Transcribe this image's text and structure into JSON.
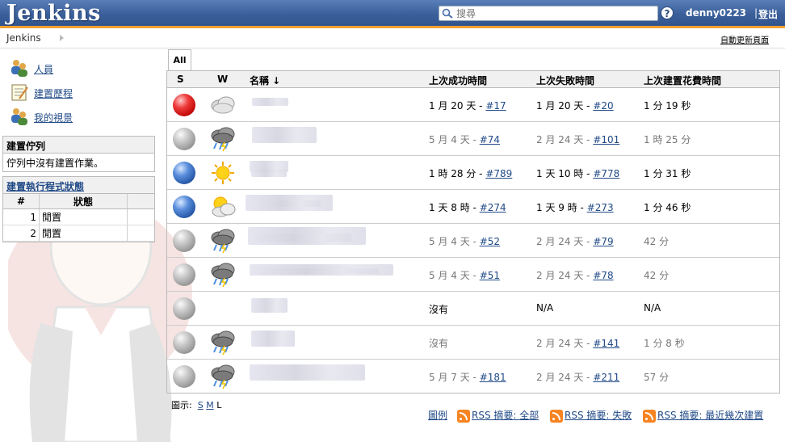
{
  "header": {
    "logo": "Jenkins",
    "search_placeholder": "搜尋",
    "username": "denny0223",
    "separator": "|",
    "logout": "登出"
  },
  "breadcrumb": {
    "root": "Jenkins",
    "auto_refresh": "自動更新頁面"
  },
  "sidebar": {
    "tasks": [
      {
        "label": "人員",
        "icon": "people-icon"
      },
      {
        "label": "建置歷程",
        "icon": "notepad-icon"
      },
      {
        "label": "我的視景",
        "icon": "my-views-icon"
      }
    ],
    "queue": {
      "title": "建置佇列",
      "empty": "佇列中沒有建置作業。"
    },
    "executors": {
      "title": "建置執行程式狀態",
      "col_num": "#",
      "col_status": "狀態",
      "rows": [
        {
          "num": "1",
          "status": "閒置"
        },
        {
          "num": "2",
          "status": "閒置"
        }
      ]
    }
  },
  "tab": "All",
  "table": {
    "headers": {
      "s": "S",
      "w": "W",
      "name": "名稱 ↓",
      "last_success": "上次成功時間",
      "last_failure": "上次失敗時間",
      "duration": "上次建置花費時間"
    },
    "rows": [
      {
        "status": "red",
        "weather": "cloudy",
        "success_text": "1 月 20 天 - ",
        "success_link": "#17",
        "failure_text": "1 月 20 天 - ",
        "failure_link": "#20",
        "duration": "1 分 19 秒",
        "dim": false
      },
      {
        "status": "grey",
        "weather": "storm",
        "success_text": "5 月 4 天 - ",
        "success_link": "#74",
        "failure_text": "2 月 24 天 - ",
        "failure_link": "#101",
        "duration": "1 時 25 分",
        "dim": true
      },
      {
        "status": "blue",
        "weather": "sunny",
        "success_text": "1 時 28 分 - ",
        "success_link": "#789",
        "failure_text": "1 天 10 時 - ",
        "failure_link": "#778",
        "duration": "1 分 31 秒",
        "dim": false
      },
      {
        "status": "blue",
        "weather": "partly-sunny",
        "success_text": "1 天 8 時 - ",
        "success_link": "#274",
        "failure_text": "1 天 9 時 - ",
        "failure_link": "#273",
        "duration": "1 分 46 秒",
        "dim": false
      },
      {
        "status": "grey",
        "weather": "storm",
        "success_text": "5 月 4 天 - ",
        "success_link": "#52",
        "failure_text": "2 月 24 天 - ",
        "failure_link": "#79",
        "duration": "42 分",
        "dim": true
      },
      {
        "status": "grey",
        "weather": "storm",
        "success_text": "5 月 4 天 - ",
        "success_link": "#51",
        "failure_text": "2 月 24 天 - ",
        "failure_link": "#78",
        "duration": "42 分",
        "dim": true
      },
      {
        "status": "grey",
        "weather": "none",
        "success_text": "沒有",
        "success_link": "",
        "failure_text": "N/A",
        "failure_link": "",
        "duration": "N/A",
        "dim": false
      },
      {
        "status": "grey",
        "weather": "storm",
        "success_text": "沒有",
        "success_link": "",
        "failure_text": "2 月 24 天 - ",
        "failure_link": "#141",
        "duration": "1 分 8 秒",
        "dim": true
      },
      {
        "status": "grey",
        "weather": "storm",
        "success_text": "5 月 7 天 - ",
        "success_link": "#181",
        "failure_text": "2 月 24 天 - ",
        "failure_link": "#211",
        "duration": "57 分",
        "dim": true
      }
    ]
  },
  "icon_size": {
    "label": "圖示:",
    "sizes": [
      "S",
      "M",
      "L"
    ],
    "selected": "L"
  },
  "footer": {
    "legend": "圖例",
    "rss_all": "RSS 摘要: 全部",
    "rss_failed": "RSS 摘要: 失敗",
    "rss_latest": "RSS 摘要: 最近幾次建置"
  },
  "colors": {
    "header": "#3a5f9a",
    "stripe": "#f0a030",
    "link": "#204a87",
    "rss": "#f78422"
  }
}
